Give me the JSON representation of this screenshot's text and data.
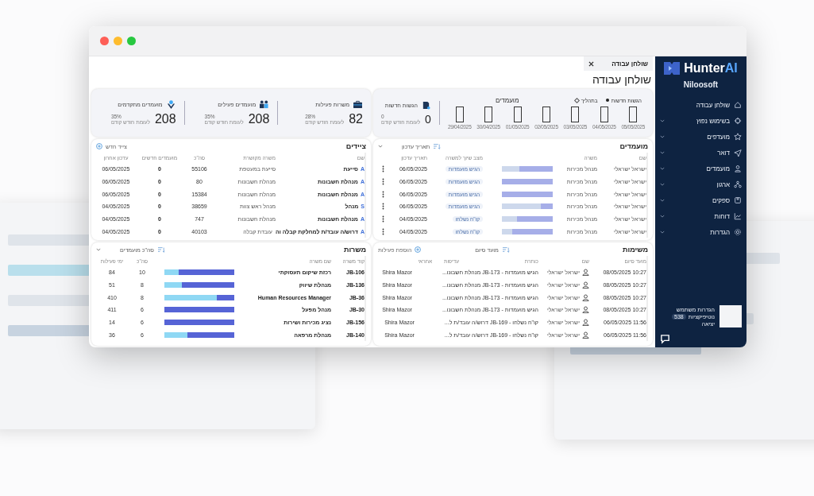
{
  "sidebar": {
    "logo": {
      "word": "Hunter",
      "accent": "AI"
    },
    "company": "Niloosoft",
    "items": [
      {
        "label": "שולחן עבודה",
        "kind": "home",
        "expandable": false
      },
      {
        "label": "בשימוש נפוץ",
        "kind": "crosshair",
        "expandable": true
      },
      {
        "label": "מועדפים",
        "kind": "star",
        "expandable": true
      },
      {
        "label": "דואר",
        "kind": "send",
        "expandable": true
      },
      {
        "label": "מועמדים",
        "kind": "person",
        "expandable": true
      },
      {
        "label": "ארגון",
        "kind": "org",
        "expandable": true
      },
      {
        "label": "ספקים",
        "kind": "box",
        "expandable": true
      },
      {
        "label": "דוחות",
        "kind": "chart",
        "expandable": true
      },
      {
        "label": "הגדרות",
        "kind": "gear",
        "expandable": true
      }
    ],
    "user": {
      "settings": "הגדרות משתמש",
      "notifications": "נוטיפיקציות",
      "notifications_count": "538",
      "logout": "יציאה"
    }
  },
  "tab": {
    "label": "שולחן עבודה"
  },
  "title": "שולחן עבודה",
  "submissions": {
    "label": "הגשות חדשות",
    "value": "0",
    "change": "0",
    "compare": "לעומת חודש קודם",
    "chart_title": "מועמדים",
    "legend": [
      {
        "label": "הגשות חדשות",
        "kind": "dot"
      },
      {
        "label": "בתהליך",
        "kind": "diamond"
      }
    ],
    "dates": [
      "05/05/2025",
      "04/05/2025",
      "03/05/2025",
      "02/05/2025",
      "01/05/2025",
      "30/04/2025",
      "29/04/2025"
    ]
  },
  "stats": [
    {
      "kind": "jobs",
      "label": "משרות פעילות",
      "value": "82",
      "change": "28%",
      "compare": "לעומת חודש קודם"
    },
    {
      "kind": "candidates",
      "label": "מועמדים פעילים",
      "value": "208",
      "change": "35%",
      "compare": "לעומת חודש קודם"
    },
    {
      "kind": "advanced",
      "label": "מועמדים מתקדמים",
      "value": "208",
      "change": "35%",
      "compare": "לעומת חודש קודם"
    }
  ],
  "candidates": {
    "title": "מועמדים",
    "sort": "תאריך עדכון",
    "columns": [
      "שם",
      "משרה",
      "מצב שיוך למשרה",
      "תאריך עדכון"
    ],
    "rows": [
      {
        "name": "ישראל ישראלי",
        "job": "מנהל מכירות",
        "level": 0.66,
        "status": "הגיש מועמדות",
        "date": "06/05/2025"
      },
      {
        "name": "ישראל ישראלי",
        "job": "מנהל מכירות",
        "level": 1,
        "status": "הגיש מועמדות",
        "date": "06/05/2025"
      },
      {
        "name": "ישראל ישראלי",
        "job": "מנהל מכירות",
        "level": 1,
        "status": "הגיש מועמדות",
        "date": "06/05/2025"
      },
      {
        "name": "ישראל ישראלי",
        "job": "מנהל מכירות",
        "level": 0.24,
        "status": "הגיש מועמדות",
        "date": "06/05/2025"
      },
      {
        "name": "ישראל ישראלי",
        "job": "מנהל מכירות",
        "level": 0.71,
        "status": "קו\"ח נשלחו",
        "date": "04/05/2025"
      },
      {
        "name": "ישראל ישראלי",
        "job": "מנהל מכירות",
        "level": 0.8,
        "status": "קו\"ח נשלחו",
        "date": "04/05/2025"
      }
    ]
  },
  "hunters": {
    "title": "ציידים",
    "action": "צייד חדש",
    "columns": [
      "שם",
      "משרה מקושרת",
      "סה\"כ",
      "מועמדים חדשים",
      "עדכון אחרון"
    ],
    "rows": [
      {
        "badge": "A",
        "name": "סייעת",
        "job": "סייעת במעטפת",
        "total": "55106",
        "new": "0",
        "date": "06/05/2025"
      },
      {
        "badge": "A",
        "name": "מנהלת חשבונות",
        "job": "מנהלת חשבונות",
        "total": "80",
        "new": "0",
        "date": "06/05/2025"
      },
      {
        "badge": "A",
        "name": "מנהלת חשבונות",
        "job": "מנהלת חשבונות",
        "total": "15384",
        "new": "0",
        "date": "06/05/2025"
      },
      {
        "badge": "S",
        "name": "מנהל",
        "job": "מנהל ראש צוות",
        "total": "38659",
        "new": "0",
        "date": "04/05/2025"
      },
      {
        "badge": "A",
        "name": "מנהלת חשבונות",
        "job": "מנהלת חשבונות",
        "total": "747",
        "new": "0",
        "date": "04/05/2025"
      },
      {
        "badge": "A",
        "name": "דרוש/ה עובד/ת למחלקת קבלה וה",
        "job": "עובדת קבלה",
        "total": "40103",
        "new": "0",
        "date": "04/05/2025"
      }
    ]
  },
  "tasks": {
    "title": "משימות",
    "sort": "מועד סיום",
    "action": "הוספת פעילות",
    "columns": [
      "מועד סיום",
      "שם",
      "כותרת",
      "עדיפות",
      "אחראי"
    ],
    "rows": [
      {
        "due": "10:27 08/05/2025",
        "name": "ישראל ישראלי",
        "subject": "הגיש מועמדות - JB-173 מנהלת חשבונו...",
        "owner": "Shira Mazor"
      },
      {
        "due": "10:27 08/05/2025",
        "name": "ישראל ישראלי",
        "subject": "הגיש מועמדות - JB-173 מנהלת חשבונו...",
        "owner": "Shira Mazor"
      },
      {
        "due": "10:27 08/05/2025",
        "name": "ישראל ישראלי",
        "subject": "הגיש מועמדות - JB-173 מנהלת חשבונו...",
        "owner": "Shira Mazor"
      },
      {
        "due": "10:27 08/05/2025",
        "name": "ישראל ישראלי",
        "subject": "הגיש מועמדות - JB-173 מנהלת חשבונו...",
        "owner": "Shira Mazor"
      },
      {
        "due": "11:56 06/05/2025",
        "name": "ישראל ישראלי",
        "subject": "קו\"ח נשלחו - JB-169 דרוש/ה עובד/ת ל...",
        "owner": "Shira Mazor"
      },
      {
        "due": "11:56 06/05/2025",
        "name": "ישראל ישראלי",
        "subject": "קו\"ח נשלחו - JB-169 דרוש/ה עובד/ת ל...",
        "owner": "Shira Mazor"
      }
    ]
  },
  "jobs": {
    "title": "משרות",
    "sort": "סה\"כ מועמדים",
    "columns": [
      "קוד משרה",
      "שם משרה",
      "סה\"כ",
      "ימי פעילות"
    ],
    "rows": [
      {
        "code": "JB-106",
        "name": "רכזת שיקום תעסוקתי",
        "level": 0.8,
        "total": "10",
        "days": "84"
      },
      {
        "code": "JB-136",
        "name": "מנהלת שיווק",
        "level": 0.75,
        "total": "8",
        "days": "51"
      },
      {
        "code": "JB-36",
        "name": "Human Resources Manager",
        "level": 0.25,
        "total": "8",
        "days": "410"
      },
      {
        "code": "JB-30",
        "name": "מנהל מפעל",
        "level": 1,
        "total": "6",
        "days": "411"
      },
      {
        "code": "JB-156",
        "name": "נציג מכירות ושירות",
        "level": 1,
        "total": "6",
        "days": "14"
      },
      {
        "code": "JB-140",
        "name": "מנהלת מרפאה",
        "level": 0.67,
        "total": "6",
        "days": "36"
      }
    ]
  }
}
